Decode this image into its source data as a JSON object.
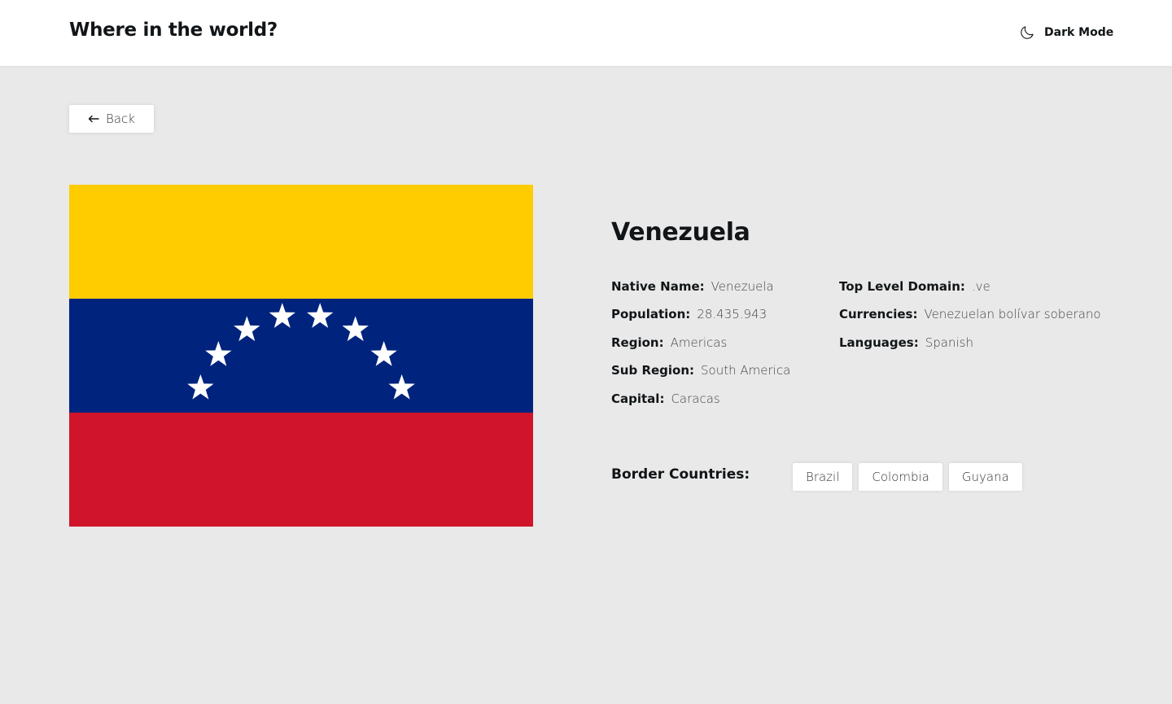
{
  "header": {
    "title": "Where in the world?",
    "theme_toggle": {
      "label": "Dark Mode",
      "icon": "moon-icon"
    }
  },
  "back_button": {
    "label": "Back",
    "icon": "arrow-left-icon"
  },
  "flag": {
    "stripe_colors": [
      "#FFCC00",
      "#00247D",
      "#CF142B"
    ],
    "star_color": "#FFFFFF",
    "star_count": 8
  },
  "country": {
    "name": "Venezuela",
    "details_left": [
      {
        "label": "Native Name:",
        "value": "Venezuela"
      },
      {
        "label": "Population:",
        "value": "28.435.943"
      },
      {
        "label": "Region:",
        "value": "Americas"
      },
      {
        "label": "Sub Region:",
        "value": "South America"
      },
      {
        "label": "Capital:",
        "value": "Caracas"
      }
    ],
    "details_right": [
      {
        "label": "Top Level Domain:",
        "value": ".ve"
      },
      {
        "label": "Currencies:",
        "value": "Venezuelan bolívar soberano"
      },
      {
        "label": "Languages:",
        "value": "Spanish"
      }
    ],
    "border_label": "Border Countries:",
    "borders": [
      "Brazil",
      "Colombia",
      "Guyana"
    ]
  },
  "colors": {
    "background": "#E9E9E9",
    "surface": "#FFFFFF",
    "text": "#111517"
  }
}
